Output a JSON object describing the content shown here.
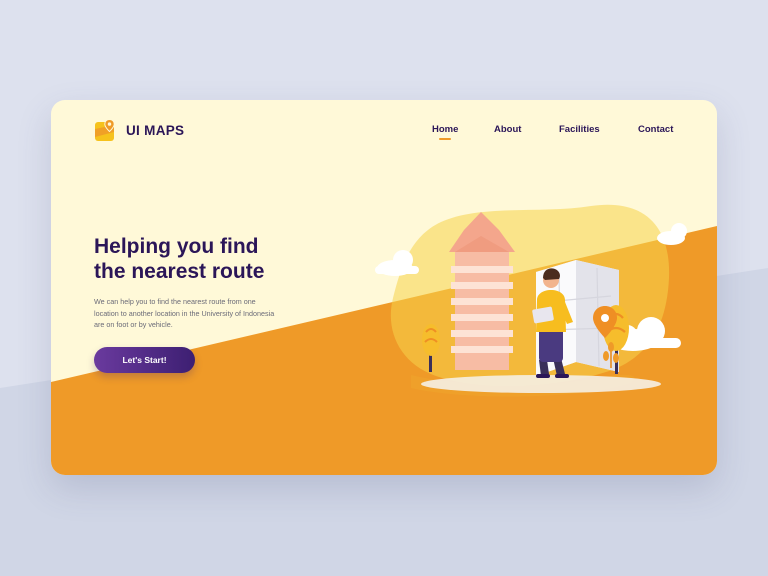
{
  "brand": {
    "name": "UI MAPS",
    "icon": "map-pin-icon"
  },
  "nav": {
    "items": [
      {
        "label": "Home",
        "active": true
      },
      {
        "label": "About",
        "active": false
      },
      {
        "label": "Facilities",
        "active": false
      },
      {
        "label": "Contact",
        "active": false
      }
    ]
  },
  "hero": {
    "title_line1": "Helping you find",
    "title_line2": "the nearest route",
    "description": "We can help you to find the nearest route from one location to another location in the University of Indonesia are on foot or by vehicle.",
    "cta_label": "Let's Start!"
  },
  "colors": {
    "page_background": "#dde1ee",
    "card_background": "#fff9d8",
    "accent_orange": "#ef9a28",
    "brand_purple": "#2b1658",
    "button_gradient_start": "#6a3a9e",
    "button_gradient_end": "#3d1f72"
  }
}
